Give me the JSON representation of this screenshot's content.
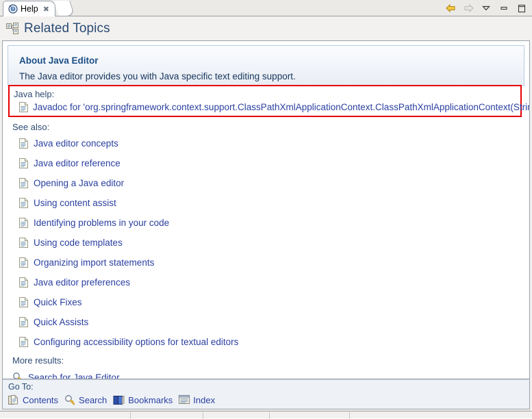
{
  "window": {
    "tab": {
      "label": "Help",
      "icon": "help-icon",
      "close_glyph": "✖"
    },
    "toolbar": [
      {
        "name": "back-button",
        "icon": "left-arrow-icon",
        "enabled": true
      },
      {
        "name": "forward-button",
        "icon": "right-arrow-icon",
        "enabled": false
      },
      {
        "name": "view-menu-button",
        "icon": "chevron-down-icon",
        "enabled": true
      },
      {
        "name": "minimize-button",
        "icon": "minimize-icon",
        "enabled": true
      },
      {
        "name": "maximize-button",
        "icon": "maximize-icon",
        "enabled": true
      }
    ]
  },
  "page": {
    "title": "Related Topics",
    "title_icon": "related-topics-icon"
  },
  "about": {
    "heading": "About Java Editor",
    "description": "The Java editor provides you with Java specific text editing support."
  },
  "java_help": {
    "label": "Java help:",
    "link": "Javadoc for 'org.springframework.context.support.ClassPathXmlApplicationContext.ClassPathXmlApplicationContext(String)'",
    "highlight_color": "#e60000"
  },
  "see_also": {
    "label": "See also:",
    "items": [
      "Java editor concepts",
      "Java editor reference",
      "Opening a Java editor",
      "Using content assist",
      "Identifying problems in your code",
      "Using code templates",
      "Organizing import statements",
      "Java editor preferences",
      "Quick Fixes",
      "Quick Assists",
      "Configuring accessibility options for textual editors"
    ]
  },
  "more_results": {
    "label": "More results:",
    "link": "Search for Java Editor",
    "icon": "search-icon"
  },
  "go_to": {
    "label": "Go To:",
    "items": [
      {
        "label": "Contents",
        "icon": "contents-icon"
      },
      {
        "label": "Search",
        "icon": "search-icon"
      },
      {
        "label": "Bookmarks",
        "icon": "bookmarks-icon"
      },
      {
        "label": "Index",
        "icon": "index-icon"
      }
    ]
  },
  "colors": {
    "link": "#2a3fa0",
    "heading": "#1c4f86",
    "section_label": "#2b4a73",
    "highlight": "#e60000"
  }
}
